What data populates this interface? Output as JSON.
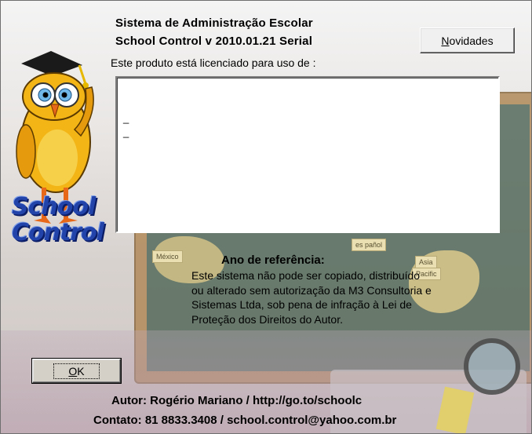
{
  "header": {
    "title_line1": "Sistema de Administração Escolar",
    "title_line2": "School Control v 2010.01.21 Serial",
    "license_label": "Este produto está licenciado para  uso de :"
  },
  "buttons": {
    "novidades_prefix": "N",
    "novidades_rest": "ovidades",
    "ok_prefix": "O",
    "ok_rest": "K"
  },
  "logo": {
    "line1": "School",
    "line2": "Control",
    "brand_color": "#2244aa"
  },
  "license_box": {
    "lines": [
      "_",
      "_"
    ]
  },
  "reference": {
    "label": "Ano de referência:"
  },
  "disclaimer": {
    "lines": [
      "Este sistema não pode ser copiado, distribuído",
      "ou alterado sem autorização da M3 Consultoria e",
      "Sistemas Ltda, sob pena de infração à Lei de",
      "Proteção dos Direitos do Autor."
    ]
  },
  "footer": {
    "author": "Autor: Rogério Mariano / http://go.to/schoolc",
    "contact": "Contato: 81 8833.3408 / school.control@yahoo.com.br"
  },
  "background": {
    "map_labels": [
      "México",
      "Asia",
      "Pacific",
      "es pañol"
    ]
  }
}
